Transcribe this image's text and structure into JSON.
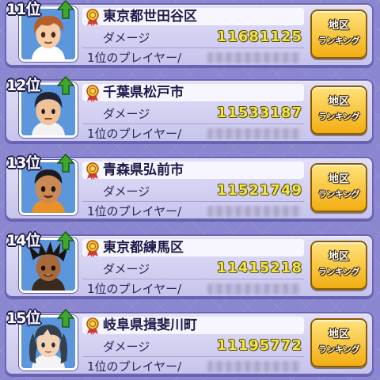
{
  "ranking": {
    "damage_label": "ダメージ",
    "player_label": "1位のプレイヤー/",
    "button_line1": "地区",
    "button_line2": "ランキング",
    "rank_trend_icon": "up-arrow-icon",
    "region_icon": "medal-icon",
    "entries": [
      {
        "rank": "11位",
        "region": "東京都世田谷区",
        "damage": "11681125",
        "avatar": "brown-hair-boy"
      },
      {
        "rank": "12位",
        "region": "千葉県松戸市",
        "damage": "11533187",
        "avatar": "dark-hair-boy"
      },
      {
        "rank": "13位",
        "region": "青森県弘前市",
        "damage": "11521749",
        "avatar": "tan-boy"
      },
      {
        "rank": "14位",
        "region": "東京都練馬区",
        "damage": "11415218",
        "avatar": "spiky-hair-boy"
      },
      {
        "rank": "15位",
        "region": "岐阜県揖斐川町",
        "damage": "11195772",
        "avatar": "braided-hair-girl"
      }
    ]
  },
  "colors": {
    "background": "#8a86cf",
    "card": "#d9d7f4",
    "card_border": "#6964b8",
    "damage_value": "#f3e24a",
    "button": "#f5c12e",
    "arrow": "#3fa82c"
  }
}
